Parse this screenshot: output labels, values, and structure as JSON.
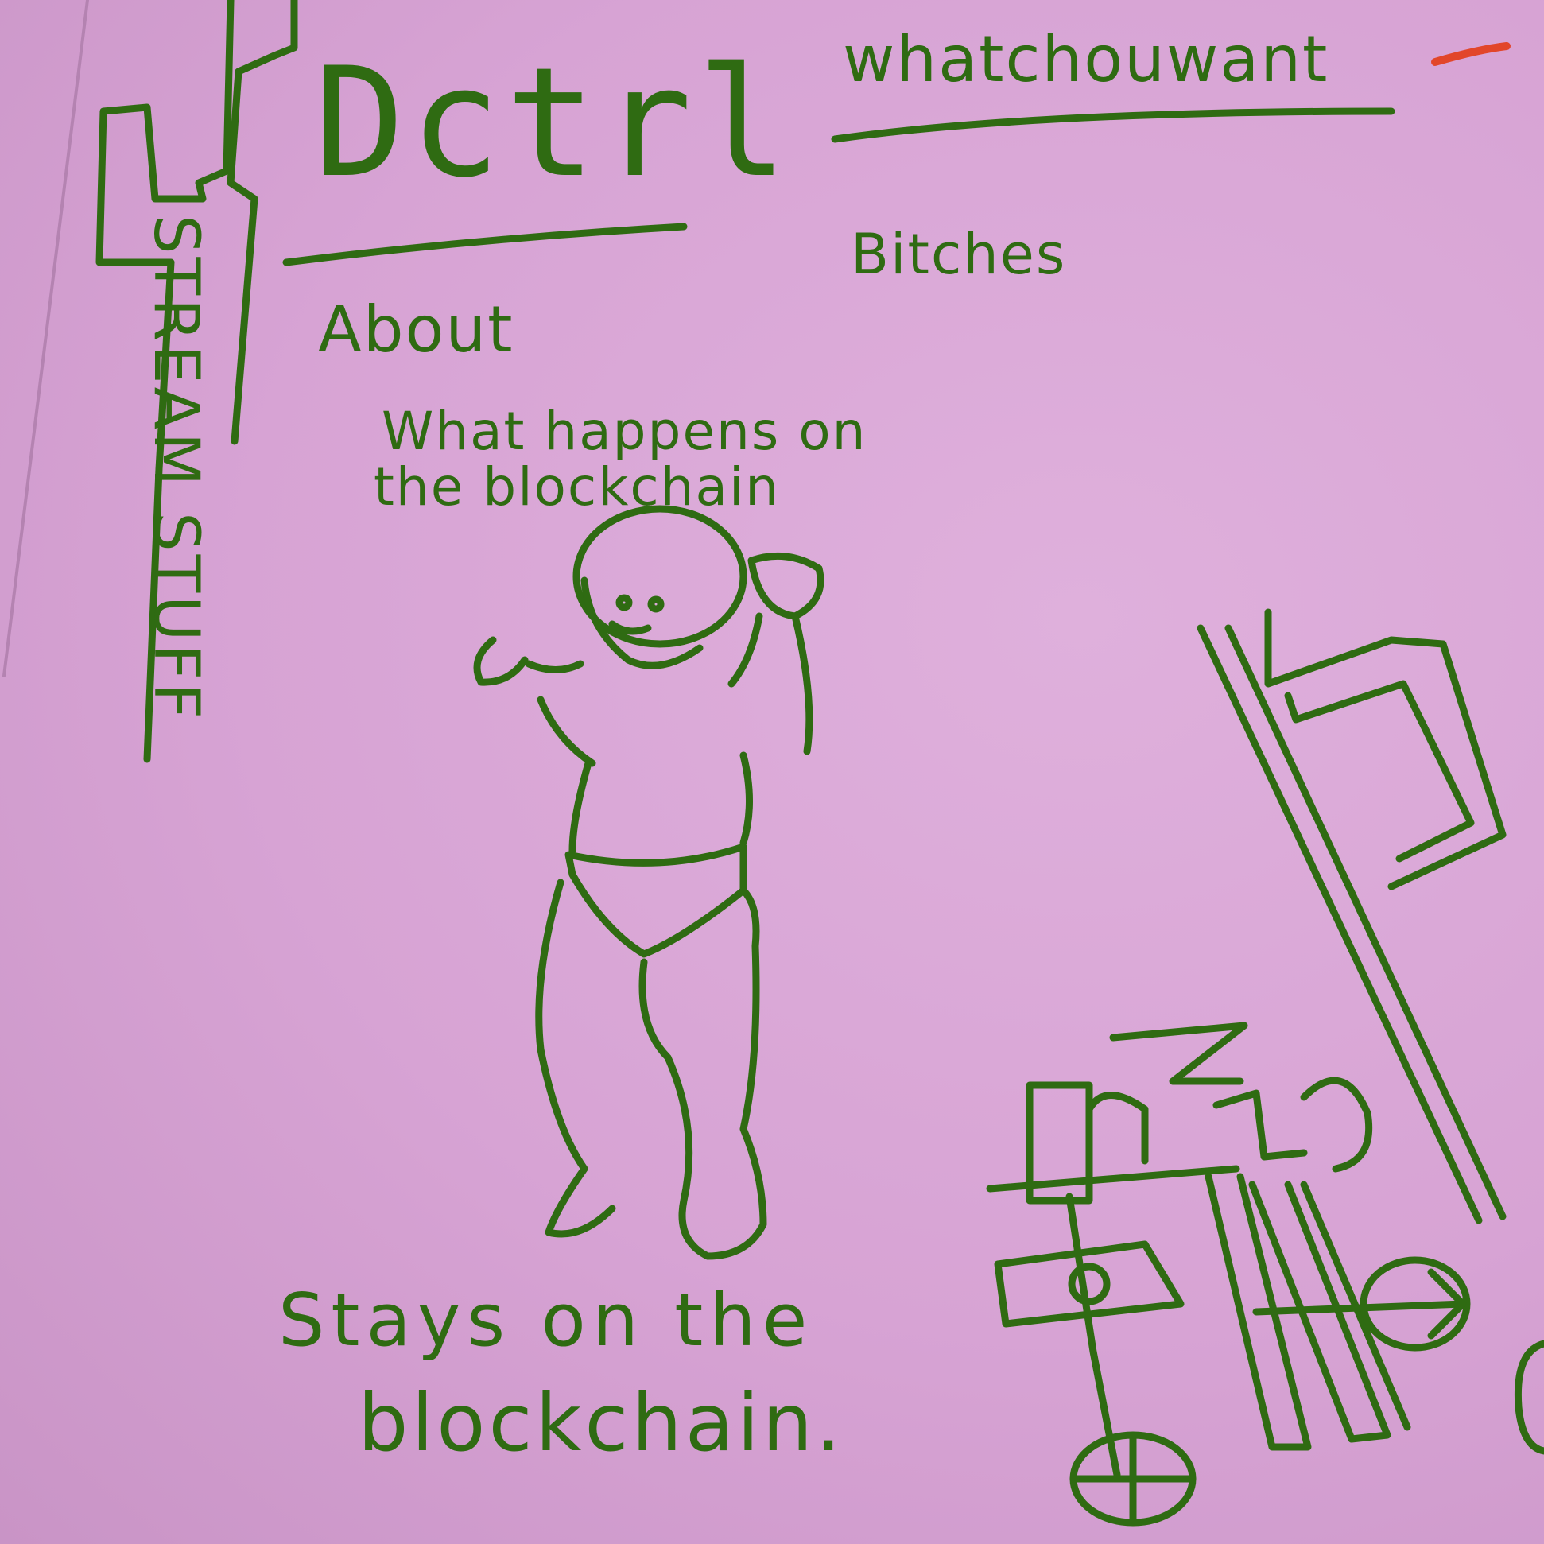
{
  "header": {
    "title": "Dctrl"
  },
  "nav": {
    "about": "About",
    "whatchouwant": "whatchouwant",
    "bitches": "Bitches"
  },
  "sidebar": {
    "label": "STREAM STUFF"
  },
  "main": {
    "caption_top_line1": "What happens on",
    "caption_top_line2": "the blockchain",
    "caption_bottom_line1": "Stays on the",
    "caption_bottom_line2": "blockchain."
  },
  "illustrations": {
    "center": "baby-figure",
    "right": "robot-figure"
  },
  "colors": {
    "paper": "#d9a6d6",
    "ink": "#2f6b12",
    "marker_accent": "#e2462a"
  }
}
